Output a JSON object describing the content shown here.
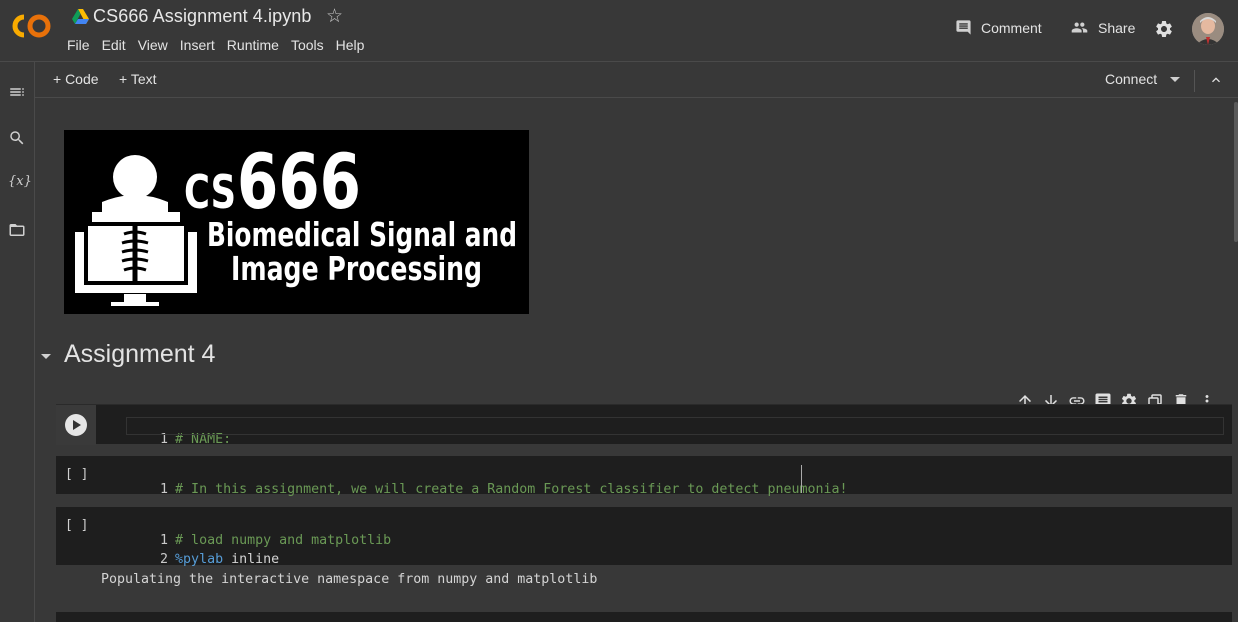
{
  "header": {
    "title": "CS666 Assignment 4.ipynb",
    "menu": [
      "File",
      "Edit",
      "View",
      "Insert",
      "Runtime",
      "Tools",
      "Help"
    ],
    "comment_label": "Comment",
    "share_label": "Share"
  },
  "toolbar": {
    "add_code_label": "+ Code",
    "add_text_label": "+ Text",
    "connect_label": "Connect"
  },
  "banner": {
    "course_prefix": "CS",
    "course_number": "666",
    "line1": "Biomedical Signal and",
    "line2": "Image Processing"
  },
  "notebook": {
    "heading": "Assignment 4",
    "cells": [
      {
        "prompt": "",
        "lines": [
          {
            "num": "1",
            "text": "# NAME:"
          }
        ]
      },
      {
        "prompt": "[ ]",
        "lines": [
          {
            "num": "1",
            "text": "# In this assignment, we will create a Random Forest classifier to detect pneumonia!"
          }
        ]
      },
      {
        "prompt": "[ ]",
        "lines": [
          {
            "num": "1",
            "text": "# load numpy and matplotlib"
          },
          {
            "num": "2",
            "magic": "%pylab",
            "rest": " inline"
          }
        ],
        "output": "Populating the interactive namespace from numpy and matplotlib"
      }
    ]
  },
  "colors": {
    "background": "#383838",
    "cell_bg": "#1e1e1e",
    "comment": "#6a9955",
    "magic": "#569cd6",
    "logo_orange": "#f9ab00"
  }
}
